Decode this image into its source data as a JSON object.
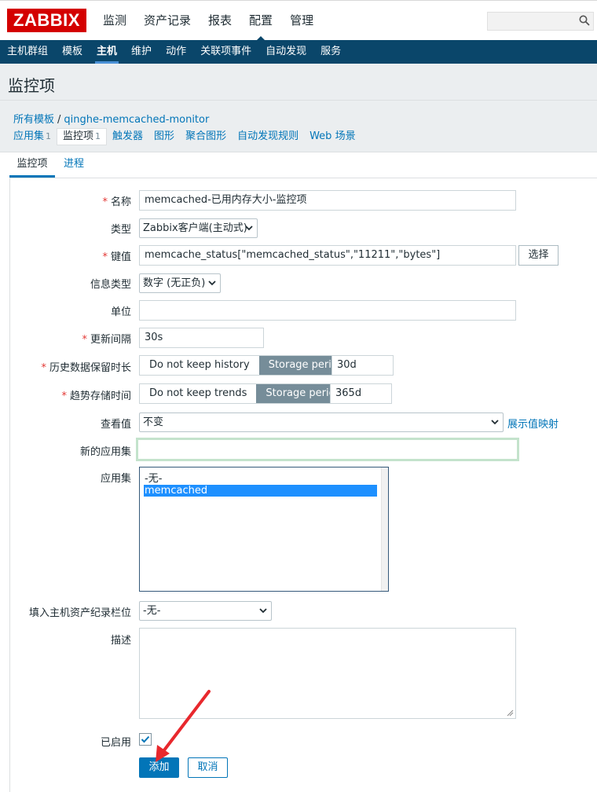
{
  "logo": "ZABBIX",
  "top_menu": [
    {
      "label": "监测",
      "active": false
    },
    {
      "label": "资产记录",
      "active": false
    },
    {
      "label": "报表",
      "active": false
    },
    {
      "label": "配置",
      "active": true
    },
    {
      "label": "管理",
      "active": false
    }
  ],
  "search": {
    "value": "",
    "icon": "search-icon"
  },
  "sub_menu": [
    {
      "label": "主机群组",
      "active": false
    },
    {
      "label": "模板",
      "active": false
    },
    {
      "label": "主机",
      "active": true
    },
    {
      "label": "维护",
      "active": false
    },
    {
      "label": "动作",
      "active": false
    },
    {
      "label": "关联项事件",
      "active": false
    },
    {
      "label": "自动发现",
      "active": false
    },
    {
      "label": "服务",
      "active": false
    }
  ],
  "page_title": "监控项",
  "breadcrumb": {
    "root": "所有模板",
    "separator": "/",
    "current": "qinghe-memcached-monitor"
  },
  "host_tabs": [
    {
      "label": "应用集",
      "count": "1",
      "active": false
    },
    {
      "label": "监控项",
      "count": "1",
      "active": true
    },
    {
      "label": "触发器",
      "count": "",
      "active": false
    },
    {
      "label": "图形",
      "count": "",
      "active": false
    },
    {
      "label": "聚合图形",
      "count": "",
      "active": false
    },
    {
      "label": "自动发现规则",
      "count": "",
      "active": false
    },
    {
      "label": "Web 场景",
      "count": "",
      "active": false
    }
  ],
  "form_tabs": {
    "item": "监控项",
    "process": "进程"
  },
  "form": {
    "name": {
      "label": "名称",
      "required": true,
      "value": "memcached-已用内存大小-监控项"
    },
    "type": {
      "label": "类型",
      "value": "Zabbix客户端(主动式)"
    },
    "key": {
      "label": "键值",
      "required": true,
      "value": "memcache_status[\"memcached_status\",\"11211\",\"bytes\"]",
      "select_button": "选择"
    },
    "info_type": {
      "label": "信息类型",
      "value": "数字 (无正负)"
    },
    "units": {
      "label": "单位",
      "value": ""
    },
    "interval": {
      "label": "更新间隔",
      "required": true,
      "value": "30s"
    },
    "history": {
      "label": "历史数据保留时长",
      "required": true,
      "option_off": "Do not keep history",
      "option_on": "Storage period",
      "value": "30d"
    },
    "trends": {
      "label": "趋势存储时间",
      "required": true,
      "option_off": "Do not keep trends",
      "option_on": "Storage period",
      "value": "365d"
    },
    "show_value": {
      "label": "查看值",
      "value": "不变",
      "link": "展示值映射"
    },
    "new_application": {
      "label": "新的应用集",
      "value": ""
    },
    "applications": {
      "label": "应用集",
      "options": [
        {
          "label": "-无-",
          "selected": false
        },
        {
          "label": "memcached",
          "selected": true
        }
      ]
    },
    "inventory": {
      "label": "填入主机资产纪录栏位",
      "value": "-无-"
    },
    "description": {
      "label": "描述",
      "value": ""
    },
    "enabled": {
      "label": "已启用",
      "checked": true
    },
    "add_button": "添加",
    "cancel_button": "取消"
  },
  "colors": {
    "brand": "#d40000",
    "nav_bg": "#0a466a",
    "link": "#0275b8",
    "required": "#e33734",
    "annotation_arrow": "#e8282d"
  }
}
